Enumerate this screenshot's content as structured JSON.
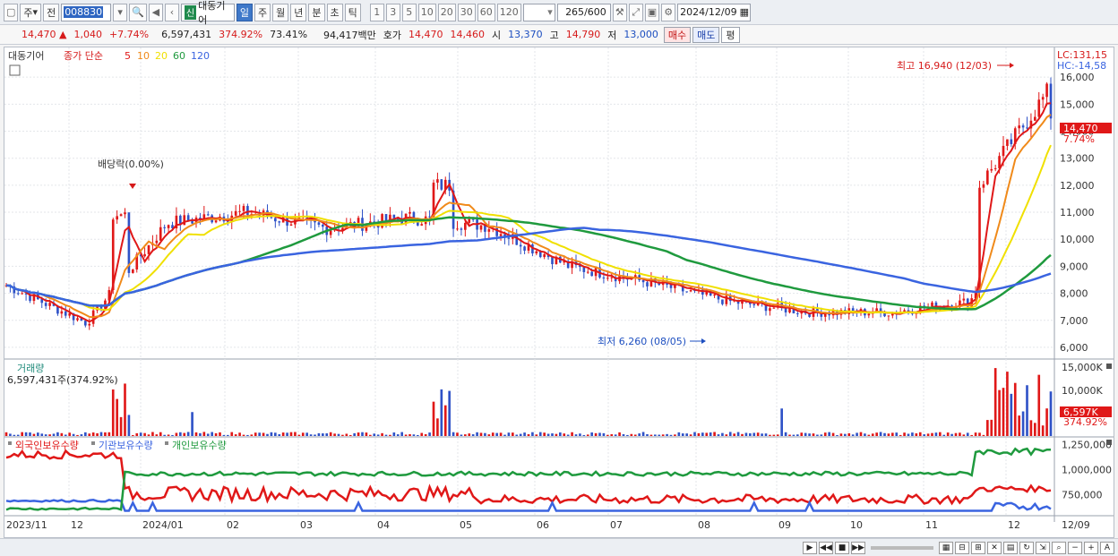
{
  "toolbar": {
    "period_label": "주",
    "prev_label": "전",
    "code": "008830",
    "badge": "신",
    "stock_name": "대동기어",
    "tabs": [
      "일",
      "주",
      "월",
      "년",
      "분",
      "초",
      "틱"
    ],
    "active_tab": "일",
    "numbers": [
      "1",
      "3",
      "5",
      "10",
      "20",
      "30",
      "60",
      "120"
    ],
    "count": "265",
    "count_max": "/600",
    "date": "2024/12/09"
  },
  "quote": {
    "price": "14,470",
    "arrow": "▲",
    "change": "1,040",
    "change_pct": "+7.74%",
    "volume": "6,597,431",
    "volume_ratio": "374.92%",
    "turnover": "73.41%",
    "amount": "94,417백만",
    "bid_label": "호가",
    "ask": "14,470",
    "bid": "14,460",
    "open_label": "시",
    "open": "13,370",
    "high_label": "고",
    "high": "14,790",
    "low_label": "저",
    "low": "13,000",
    "buy_label": "매수",
    "sell_label": "매도",
    "avg_label": "평"
  },
  "price_panel": {
    "name": "대동기어",
    "ma_title": "종가 단순",
    "ma_periods": [
      "5",
      "10",
      "20",
      "60",
      "120"
    ],
    "ma_colors": [
      "#e01818",
      "#f08a1a",
      "#f0e000",
      "#1f9a3e",
      "#3a64e0"
    ],
    "lc_label": "LC:131,15",
    "hc_label": "HC:-14,58",
    "current_tag": "14,470",
    "pct_tag": "7.74%",
    "max_label": "최고 16,940 (12/03)",
    "min_label": "최저 6,260 (08/05)",
    "dividend_label": "배당락(0.00%)"
  },
  "volume_panel": {
    "title": "거래량",
    "subtitle": "6,597,431주(374.92%)",
    "current_tag": "6,597K",
    "pct_tag": "374.92%"
  },
  "holdings_panel": {
    "labels": [
      "외국인보유수량",
      "기관보유수량",
      "개인보유수량"
    ],
    "colors": [
      "#e01818",
      "#3a64e0",
      "#1f9a3e"
    ]
  },
  "x_axis_labels": [
    "2023/11",
    "12",
    "2024/01",
    "02",
    "03",
    "04",
    "05",
    "06",
    "07",
    "08",
    "09",
    "10",
    "11",
    "12",
    "12/09"
  ],
  "chart_data": {
    "type": "line",
    "price_axis": {
      "ticks": [
        6000,
        7000,
        8000,
        9000,
        10000,
        11000,
        12000,
        13000,
        14000,
        15000,
        16000
      ],
      "ylim": [
        5600,
        17000
      ]
    },
    "volume_axis": {
      "ticks": [
        "10,000K",
        "15,000K"
      ]
    },
    "holdings_axis": {
      "ticks": [
        "750,000",
        "1,000,000",
        "1,250,000"
      ]
    },
    "close_by_month": {
      "x": [
        "2023/11",
        "2023/12",
        "2024/01",
        "2024/02",
        "2024/03",
        "2024/04",
        "2024/05",
        "2024/06",
        "2024/07",
        "2024/08",
        "2024/09",
        "2024/10",
        "2024/11",
        "2024/12/09"
      ],
      "close": [
        8300,
        6900,
        10600,
        11000,
        10400,
        10800,
        10500,
        9000,
        8400,
        7700,
        7300,
        7300,
        7700,
        14470
      ]
    },
    "annotations": {
      "high": {
        "value": 16940,
        "date": "12/03"
      },
      "low": {
        "value": 6260,
        "date": "08/05"
      }
    }
  }
}
